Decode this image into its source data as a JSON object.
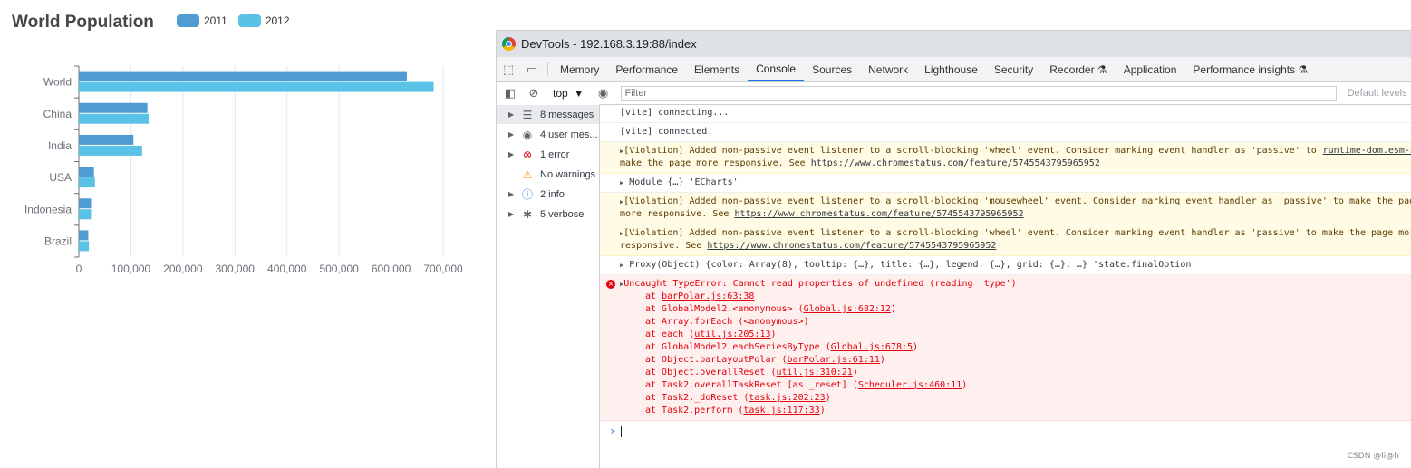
{
  "chart": {
    "title": "World Population",
    "legend": [
      {
        "name": "2011",
        "color": "#4f9cd3"
      },
      {
        "name": "2012",
        "color": "#5bc2e7"
      }
    ]
  },
  "chart_data": {
    "type": "bar",
    "orientation": "horizontal",
    "title": "World Population",
    "categories": [
      "Brazil",
      "Indonesia",
      "USA",
      "India",
      "China",
      "World"
    ],
    "series": [
      {
        "name": "2011",
        "values": [
          18203,
          23489,
          29034,
          104970,
          131744,
          630230
        ]
      },
      {
        "name": "2012",
        "values": [
          19325,
          23438,
          31000,
          121594,
          134141,
          681807
        ]
      }
    ],
    "xlim": [
      0,
      700000
    ],
    "x_ticks": [
      "0",
      "100,000",
      "200,000",
      "300,000",
      "400,000",
      "500,000",
      "600,000",
      "700,000"
    ],
    "grid": true,
    "legend_position": "top"
  },
  "devtools": {
    "window_title": "DevTools - 192.168.3.19:88/index",
    "tabs": [
      "Memory",
      "Performance",
      "Elements",
      "Console",
      "Sources",
      "Network",
      "Lighthouse",
      "Security",
      "Recorder ⚗",
      "Application",
      "Performance insights ⚗"
    ],
    "active_tab": "Console",
    "context": "top",
    "filter_placeholder": "Filter",
    "default_levels": "Default levels",
    "sidebar": [
      {
        "label": "8 messages",
        "icon": "list-icon",
        "glyph": "☰",
        "color": "#5f6368"
      },
      {
        "label": "4 user mes...",
        "icon": "user-icon",
        "glyph": "◉",
        "color": "#5f6368"
      },
      {
        "label": "1 error",
        "icon": "error-icon",
        "glyph": "⊗",
        "color": "#e4000b"
      },
      {
        "label": "No warnings",
        "icon": "warning-icon",
        "glyph": "⚠",
        "color": "#f29900"
      },
      {
        "label": "2 info",
        "icon": "info-icon",
        "glyph": "ⓘ",
        "color": "#1a73e8"
      },
      {
        "label": "5 verbose",
        "icon": "bug-icon",
        "glyph": "✱",
        "color": "#5f6368"
      }
    ],
    "messages": {
      "m1": "[vite] connecting...",
      "m2": "[vite] connected.",
      "m3_text": "[Violation] Added non-passive event listener to a scroll-blocking 'wheel' event. Consider marking event handler as 'passive' to",
      "m3_line2": "make the page more responsive. See ",
      "m3_link": "https://www.chromestatus.com/feature/5745543795965952",
      "m3_source": "runtime-dom.esm-b",
      "m4": "Module {…} 'ECharts'",
      "m5_text": "[Violation] Added non-passive event listener to a scroll-blocking 'mousewheel' event. Consider marking event handler as 'passive' to make the page",
      "m5_line2": "more responsive. See ",
      "m5_link": "https://www.chromestatus.com/feature/5745543795965952",
      "m6_text": "[Violation] Added non-passive event listener to a scroll-blocking 'wheel' event. Consider marking event handler as 'passive' to make the page more",
      "m6_line2": "responsive. See ",
      "m6_link": "https://www.chromestatus.com/feature/5745543795965952",
      "m7": "Proxy(Object) {color: Array(8), tooltip: {…}, title: {…}, legend: {…}, grid: {…}, …} 'state.finalOption'",
      "error_head": "Uncaught TypeError: Cannot read properties of undefined (reading 'type')",
      "stack": [
        {
          "text": "at ",
          "link": "barPolar.js:63:38",
          "paren": false
        },
        {
          "text": "at GlobalModel2.<anonymous> ",
          "link": "Global.js:682:12",
          "paren": true
        },
        {
          "text": "at Array.forEach (<anonymous>)",
          "link": "",
          "paren": false
        },
        {
          "text": "at each ",
          "link": "util.js:205:13",
          "paren": true
        },
        {
          "text": "at GlobalModel2.eachSeriesByType ",
          "link": "Global.js:678:5",
          "paren": true
        },
        {
          "text": "at Object.barLayoutPolar ",
          "link": "barPolar.js:61:11",
          "paren": true
        },
        {
          "text": "at Object.overallReset ",
          "link": "util.js:310:21",
          "paren": true
        },
        {
          "text": "at Task2.overallTaskReset [as _reset] ",
          "link": "Scheduler.js:460:11",
          "paren": true
        },
        {
          "text": "at Task2._doReset ",
          "link": "task.js:202:23",
          "paren": true
        },
        {
          "text": "at Task2.perform ",
          "link": "task.js:117:33",
          "paren": true
        }
      ]
    },
    "watermark": "CSDN @li@h"
  }
}
